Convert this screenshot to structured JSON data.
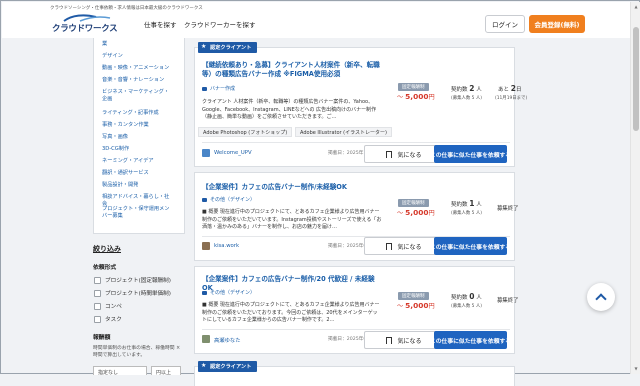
{
  "header": {
    "tagline": "クラウドソーシング・仕事依頼・求人情報は日本最大級のクラウドワークス",
    "logo_text": "クラウドワークス",
    "nav": [
      "仕事を探す",
      "クラウドワーカーを探す"
    ],
    "login_label": "ログイン",
    "register_label": "会員登録(無料)"
  },
  "sidebar": {
    "categories": [
      "業",
      "デザイン",
      "動画・映像・アニメーション",
      "音楽・音響・ナレーション",
      "ビジネス・マーケティング・企画",
      "ライティング・記事作成",
      "事務・カンタン作業",
      "写真・画像",
      "3D-CG制作",
      "ネーミング・アイデア",
      "翻訳・通訳サービス",
      "製品設計・開発",
      "相談アドバイス・暮らし・社会",
      "プロジェクト・保守運用メンバー募集"
    ],
    "refine_title": "絞り込み",
    "request_format_title": "依頼形式",
    "request_formats": [
      "プロジェクト(固定報酬制)",
      "プロジェクト(時間単価制)",
      "コンペ",
      "タスク"
    ],
    "reward_title": "報酬額",
    "reward_note": "時間単価制のお仕事の場合、稼働時間 × 時間で算出しています。",
    "reward_select_1": "指定なし",
    "reward_select_2": "円以上"
  },
  "jobs": [
    {
      "badge": "認定クライアント",
      "title": "【継続依頼あり・急募】クライアント人材案件（新卒、転職等）の種類広告バナー作成 ※FIGMA使用必須",
      "category": "バナー作成",
      "description": "クライアント 人材案件（新卒、転職等）の種類広告バナー案件の、Yahoo、Google、Facebook、Instagram、LINEなどへの 広告出稿向けのバナー制作（静止画、簡単な動画）をご依頼させていただきます。ご…",
      "skills": [
        "Adobe Photoshop (フォトショップ)",
        "Adobe Illustrator (イラストレーター)"
      ],
      "client": "Welcome_UPV",
      "published": "掲載日：2025年11月05日",
      "price_label": "固定報酬制",
      "price_prefix": "〜",
      "price": "5,000",
      "price_unit": "円",
      "contracts_label": "契約数",
      "contracts": "2",
      "contracts_unit": "人",
      "recruit": "(募集人数 5 人)",
      "remain_prefix": "あと",
      "remain": "2",
      "remain_unit": "日",
      "remain_sub": "(11月19日まで)",
      "fav_label": "気になる",
      "similar_label": "この仕事に似た仕事を依頼する"
    },
    {
      "badge": "",
      "title": "【企業案件】カフェの広告バナー制作/未経験OK",
      "category": "その他（デザイン）",
      "description": "■ 概要 現在進行中のプロジェクトにて、とあるカフェ企業様より広告用バナー制作のご依頼をいただいています。Instagram投稿やストーリーズで使える「お洒落・温かみのある」バナーを制作し、お店の魅力を届け…",
      "client": "kisa.work",
      "published": "掲載日：2025年05月18日",
      "price_label": "固定報酬制",
      "price_prefix": "〜",
      "price": "5,000",
      "price_unit": "円",
      "contracts_label": "契約数",
      "contracts": "1",
      "contracts_unit": "人",
      "recruit": "(募集人数 5 人)",
      "status": "募集終了",
      "fav_label": "気になる",
      "similar_label": "この仕事に似た仕事を依頼する"
    },
    {
      "badge": "",
      "title": "【企業案件】カフェの広告バナー制作/20 代歓迎 / 未経験 OK",
      "category": "その他（デザイン）",
      "description": "■ 概要 現在進行中のプロジェクトにて、とあるカフェ企業様より広告用バナー制作のご依頼をいただいております。今回のご依頼は、20代をメインターゲットにしているカフェ企業様からの広告バナー制作です。2…",
      "client": "高瀬ゆなた",
      "published": "掲載日：2025年05月25日",
      "price_label": "固定報酬制",
      "price_prefix": "〜",
      "price": "5,000",
      "price_unit": "円",
      "contracts_label": "契約数",
      "contracts": "0",
      "contracts_unit": "人",
      "recruit": "(募集人数 5 人)",
      "status": "募集終了",
      "fav_label": "気になる",
      "similar_label": "この仕事に似た仕事を依頼する"
    },
    {
      "badge": "認定クライアント"
    }
  ],
  "colors": {
    "brand_blue": "#1f5aa6",
    "link_blue": "#1a5ea8",
    "register_orange": "#f07f1e",
    "price_red": "#d63a2c",
    "button_blue": "#1f64c0"
  }
}
